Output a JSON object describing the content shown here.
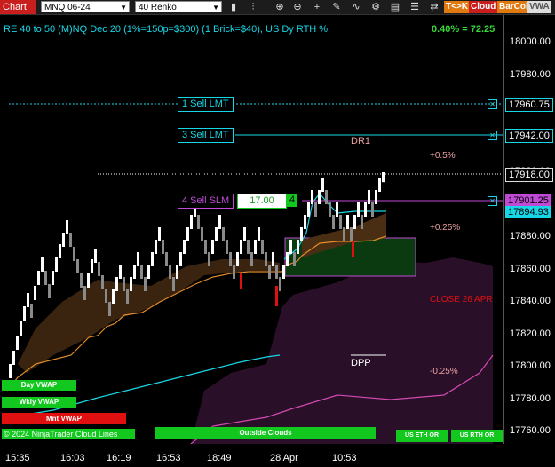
{
  "toolbar": {
    "chart_label": "Chart",
    "instrument": "MNQ 06-24",
    "period": "40 Renko",
    "tags": [
      "T<>K",
      "Cloud",
      "BarCol",
      "VWA"
    ]
  },
  "chart": {
    "title": "RE 40 to 50 (M)NQ Dec 20 (1%=150p=$300) (1 Brick=$40), US Dy RTH %",
    "pct_readout": "0.40% = 72.25"
  },
  "y_axis": {
    "ticks": [
      "18000.00",
      "17980.00",
      "17960.00",
      "17940.00",
      "17920.00",
      "17900.00",
      "17880.00",
      "17860.00",
      "17840.00",
      "17820.00",
      "17800.00",
      "17780.00",
      "17760.00"
    ]
  },
  "x_axis": {
    "ticks": [
      "15:35",
      "16:03",
      "16:19",
      "16:53",
      "18:49",
      "28 Apr",
      "10:53"
    ]
  },
  "price_tags": {
    "sell_lmt1": "17960.75",
    "sell_lmt2": "17942.00",
    "last": "17918.00",
    "sell_slm": "17901.25",
    "vwap": "17894.93"
  },
  "orders": {
    "sell_lmt1": "1 Sell LMT",
    "sell_lmt2": "3 Sell LMT",
    "sell_slm": "4 Sell SLM",
    "slm_price": "17.00",
    "slm_qty": "4"
  },
  "annotations": {
    "dr1": "DR1",
    "plus05": "+0.5%",
    "plus025": "+0.25%",
    "close_label": "CLOSE 26 APR",
    "dpp": "DPP",
    "minus025": "-0.25%"
  },
  "buttons": {
    "day_vwap": "Day VWAP",
    "wkly_vwap": "Wkly VWAP",
    "mnt_vwap": "Mnt VWAP",
    "footer_text": "© 2024 NinjaTrader Cloud Lines",
    "outside_clouds": "Outside Clouds",
    "us_eth": "US ETH OR",
    "us_rth": "US RTH OR"
  },
  "colors": {
    "cyan": "#17d7e6",
    "green": "#12c81e",
    "red": "#e01010",
    "purple": "#c04ad6"
  }
}
